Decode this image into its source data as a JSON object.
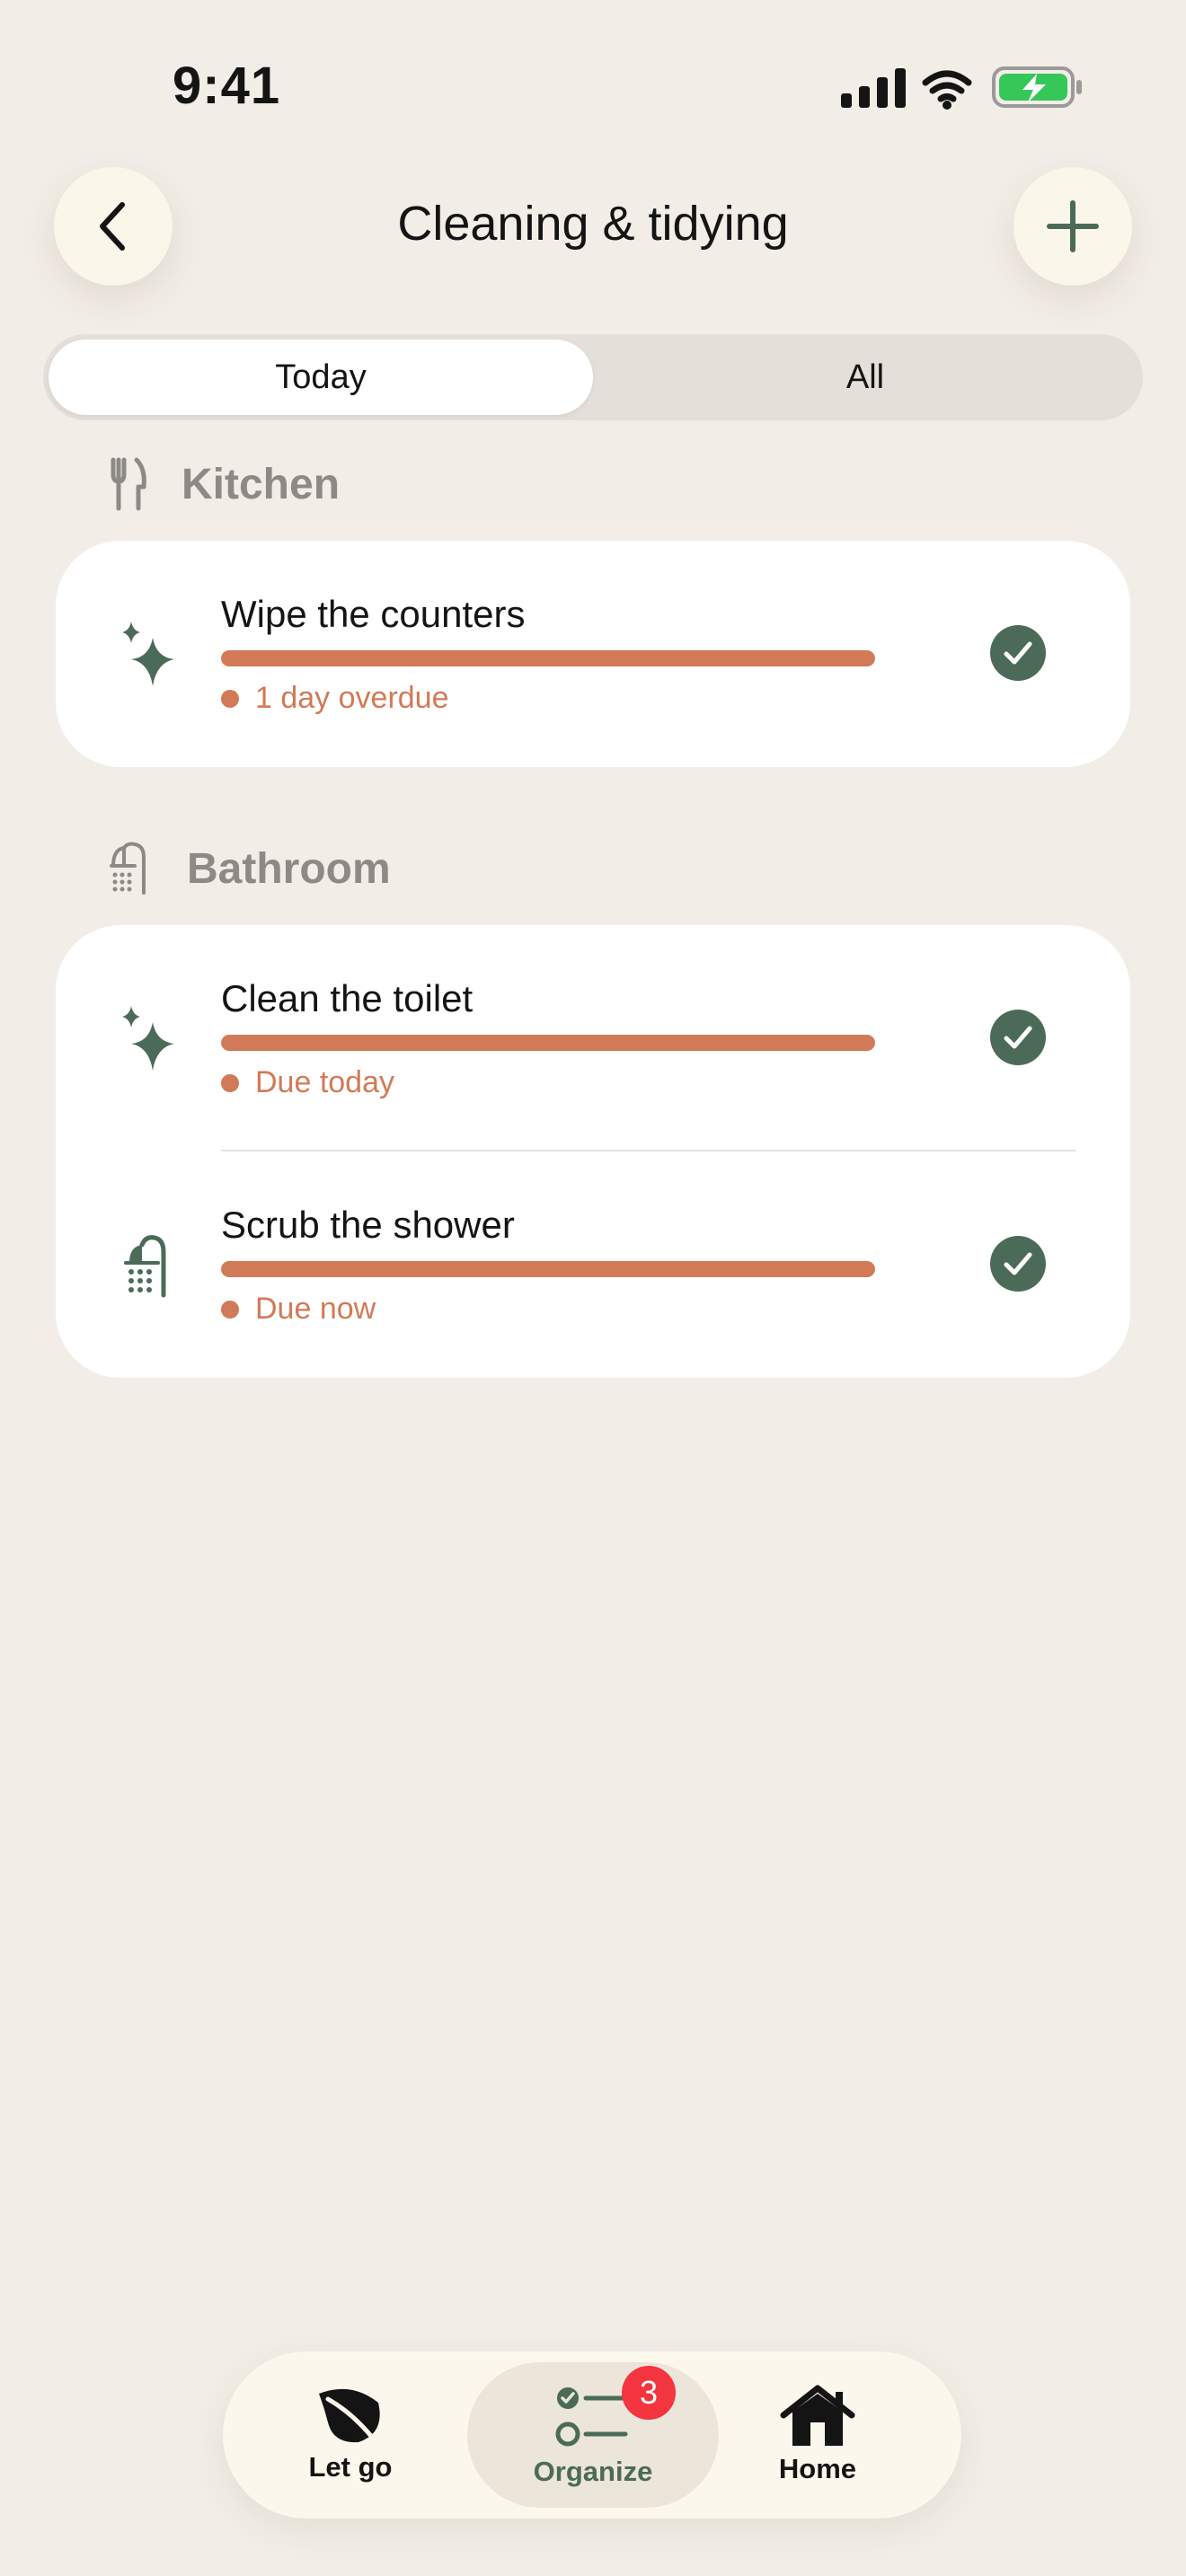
{
  "status_bar": {
    "time": "9:41"
  },
  "header": {
    "title": "Cleaning & tidying"
  },
  "segmented": {
    "today_label": "Today",
    "all_label": "All",
    "selected": "Today"
  },
  "sections": [
    {
      "label": "Kitchen",
      "icon": "fork-knife-icon",
      "tasks": [
        {
          "name": "Wipe the counters",
          "icon": "sparkles-icon",
          "due": "1 day overdue",
          "progress": 1.0
        }
      ]
    },
    {
      "label": "Bathroom",
      "icon": "shower-icon",
      "tasks": [
        {
          "name": "Clean the toilet",
          "icon": "sparkles-icon",
          "due": "Due today",
          "progress": 1.0
        },
        {
          "name": "Scrub the shower",
          "icon": "shower-icon",
          "due": "Due now",
          "progress": 1.0
        }
      ]
    }
  ],
  "tabbar": {
    "items": [
      {
        "label": "Let go",
        "icon": "leaf-icon"
      },
      {
        "label": "Organize",
        "icon": "checklist-icon",
        "badge": "3",
        "selected": true
      },
      {
        "label": "Home",
        "icon": "house-icon"
      }
    ]
  },
  "colors": {
    "background": "#f2ede6",
    "accent_green": "#4b6b58",
    "due_orange": "#d27a57",
    "badge_red": "#f3353f"
  }
}
